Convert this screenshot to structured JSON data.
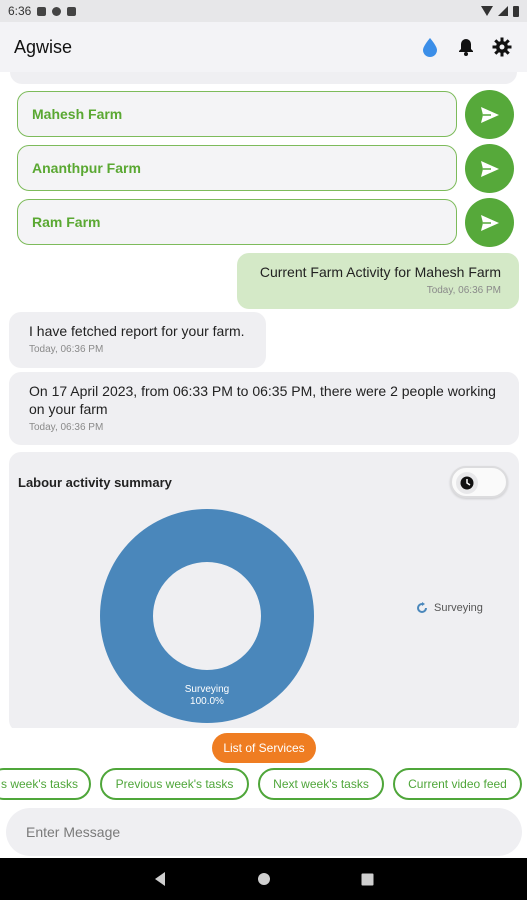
{
  "status_bar": {
    "time": "6:36"
  },
  "app_bar": {
    "title": "Agwise"
  },
  "farms": [
    {
      "name": "Mahesh Farm"
    },
    {
      "name": "Ananthpur Farm"
    },
    {
      "name": "Ram Farm"
    }
  ],
  "messages": {
    "user": {
      "text": "Current Farm Activity for Mahesh Farm",
      "time": "Today, 06:36 PM"
    },
    "bot1": {
      "text": "I have fetched report for your farm.",
      "time": "Today, 06:36 PM"
    },
    "bot2": {
      "text": "On 17 April 2023, from 06:33 PM to 06:35 PM, there were 2 people working on your farm",
      "time": "Today, 06:36 PM"
    }
  },
  "summary": {
    "title": "Labour activity summary",
    "legend_label": "Surveying"
  },
  "chart_data": {
    "type": "pie",
    "categories": [
      "Surveying"
    ],
    "values": [
      100.0
    ],
    "slice_labels": [
      "Surveying",
      "100.0%"
    ],
    "colors": [
      "#4a87bb"
    ]
  },
  "services_button": "List of Services",
  "chips": [
    "s week's tasks",
    "Previous week's tasks",
    "Next week's tasks",
    "Current video feed"
  ],
  "input": {
    "placeholder": "Enter Message"
  },
  "colors": {
    "accent_green": "#56a93a",
    "orange": "#ef7d22",
    "user_bubble": "#d4e9c7",
    "chart_blue": "#4a87bb"
  },
  "icons": [
    "water-drop-icon",
    "bell-icon",
    "gear-icon",
    "send-icon",
    "clock-icon",
    "refresh-icon",
    "back-icon",
    "home-icon",
    "recents-icon"
  ]
}
